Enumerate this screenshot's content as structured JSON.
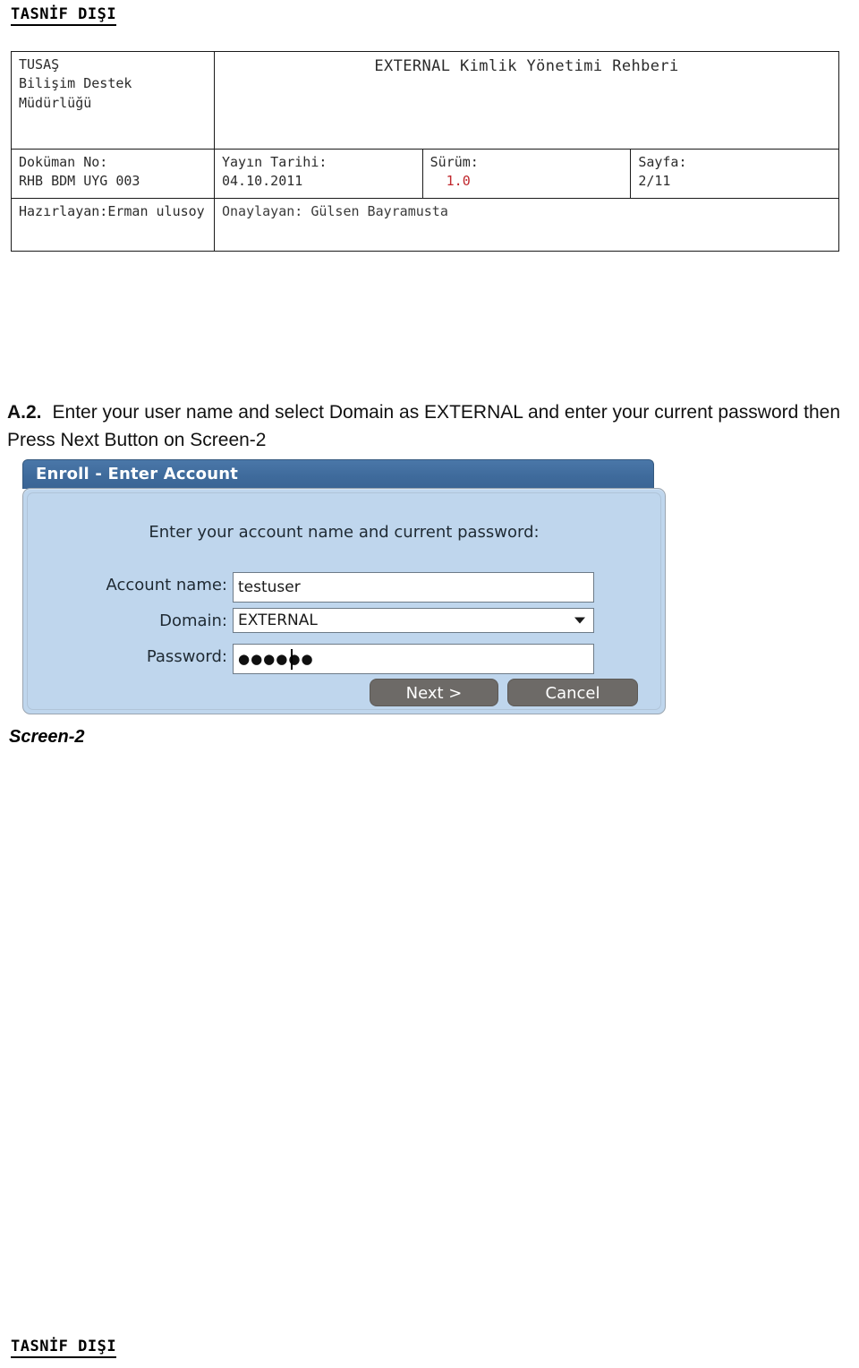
{
  "classification": {
    "top": "TASNİF DIŞI",
    "bottom": "TASNİF DIŞI"
  },
  "doc_header": {
    "org_lines": [
      "TUSAŞ",
      "Bilişim Destek",
      "Müdürlüğü"
    ],
    "document_title": "EXTERNAL Kimlik Yönetimi Rehberi",
    "doc_no_label": "Doküman No:",
    "doc_no_value": "RHB BDM UYG 003",
    "date_label": "Yayın Tarihi:",
    "date_value": "04.10.2011",
    "version_label": "Sürüm:",
    "version_value": "1.0",
    "version_color": "#c0282d",
    "page_label": "Sayfa:",
    "page_value": "2/11",
    "prepared_by": "Hazırlayan:Erman ulusoy",
    "approved_by": "Onaylayan: Gülsen Bayramusta"
  },
  "instruction": {
    "step_label": "A.2.",
    "text": "Enter your user name  and select Domain as EXTERNAL and enter your current password then Press Next Button on Screen-2"
  },
  "enroll_dialog": {
    "title": "Enroll - Enter Account",
    "prompt": "Enter your account name and current password:",
    "account_name_label": "Account name:",
    "account_name_value": "testuser",
    "domain_label": "Domain:",
    "domain_value": "EXTERNAL",
    "password_label": "Password:",
    "password_value": "●●●●●●",
    "next_button_label": "Next >",
    "cancel_button_label": "Cancel",
    "titlebar_color": "#3f6b9c",
    "body_color": "#bfd6ed",
    "button_color": "#6d6a67"
  },
  "screen_caption": "Screen-2"
}
